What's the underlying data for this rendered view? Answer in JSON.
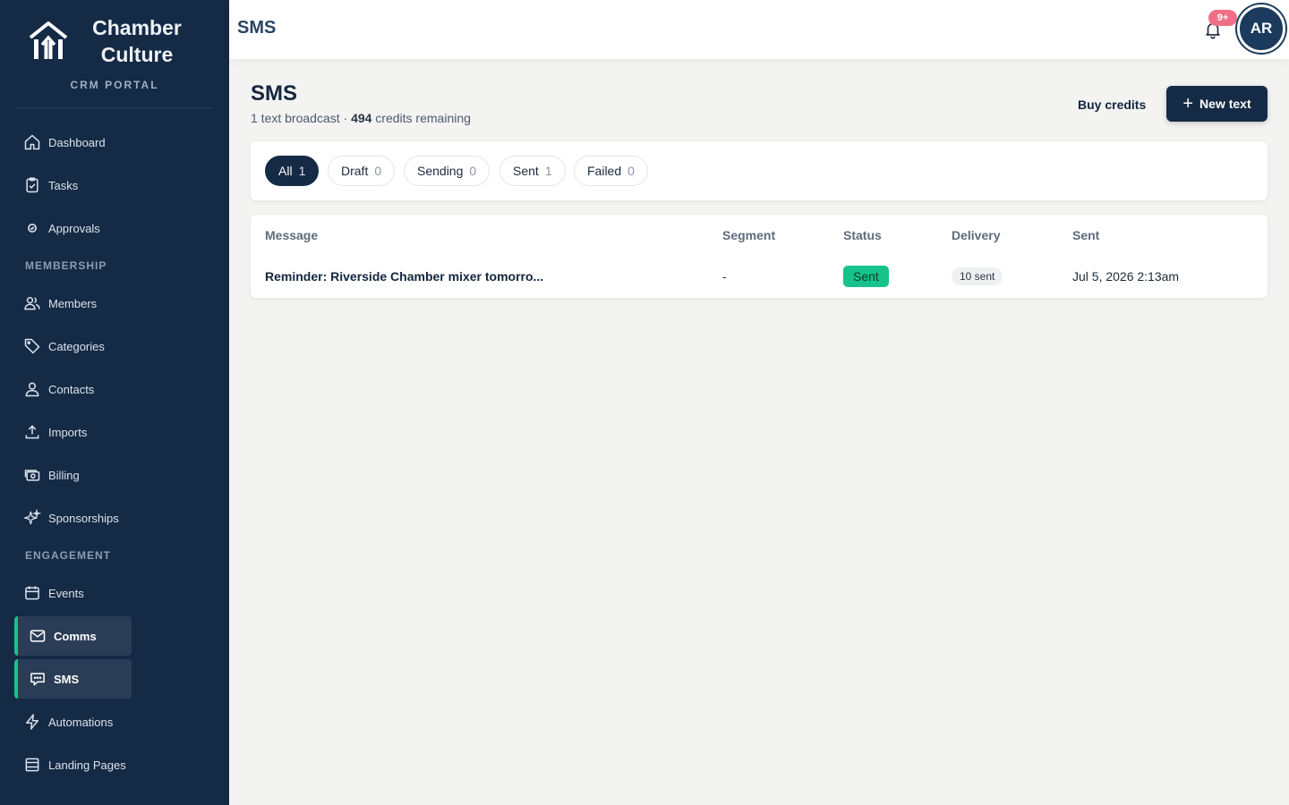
{
  "brand": {
    "name_line1": "Chamber",
    "name_line2": "Culture",
    "subtitle": "CRM PORTAL"
  },
  "sidebar": {
    "items": [
      {
        "label": "Dashboard",
        "icon": "home-icon"
      },
      {
        "label": "Tasks",
        "icon": "clipboard-check-icon"
      },
      {
        "label": "Approvals",
        "icon": "check-circle-icon"
      },
      {
        "label": "Members",
        "icon": "users-icon"
      },
      {
        "label": "Categories",
        "icon": "tag-icon"
      },
      {
        "label": "Contacts",
        "icon": "user-icon"
      },
      {
        "label": "Imports",
        "icon": "upload-icon"
      },
      {
        "label": "Billing",
        "icon": "cash-icon"
      },
      {
        "label": "Sponsorships",
        "icon": "sparkles-icon"
      },
      {
        "label": "Events",
        "icon": "calendar-icon"
      },
      {
        "label": "Comms",
        "icon": "mail-icon",
        "active": true
      },
      {
        "label": "SMS",
        "icon": "chat-icon",
        "active": true
      },
      {
        "label": "Automations",
        "icon": "bolt-icon"
      },
      {
        "label": "Landing Pages",
        "icon": "page-icon"
      }
    ],
    "sections": {
      "membership": "MEMBERSHIP",
      "engagement": "ENGAGEMENT"
    }
  },
  "topbar": {
    "title": "SMS",
    "notification_count": "9+",
    "avatar_initials": "AR"
  },
  "page": {
    "title": "SMS",
    "subtitle_prefix": "1 text broadcast · ",
    "credits": "494",
    "subtitle_suffix": " credits remaining",
    "buy_credits_label": "Buy credits",
    "new_text_label": "New text"
  },
  "filters": [
    {
      "label": "All",
      "count": "1",
      "active": true
    },
    {
      "label": "Draft",
      "count": "0"
    },
    {
      "label": "Sending",
      "count": "0"
    },
    {
      "label": "Sent",
      "count": "1"
    },
    {
      "label": "Failed",
      "count": "0"
    }
  ],
  "table": {
    "columns": [
      "Message",
      "Segment",
      "Status",
      "Delivery",
      "Sent"
    ],
    "rows": [
      {
        "message": "Reminder: Riverside Chamber mixer tomorro...",
        "segment": "-",
        "status": "Sent",
        "delivery": "10 sent",
        "sent": "Jul 5, 2026 2:13am"
      }
    ]
  },
  "colors": {
    "sidebar_bg": "#152a45",
    "accent": "#17c38b",
    "badge": "#f06f86"
  }
}
